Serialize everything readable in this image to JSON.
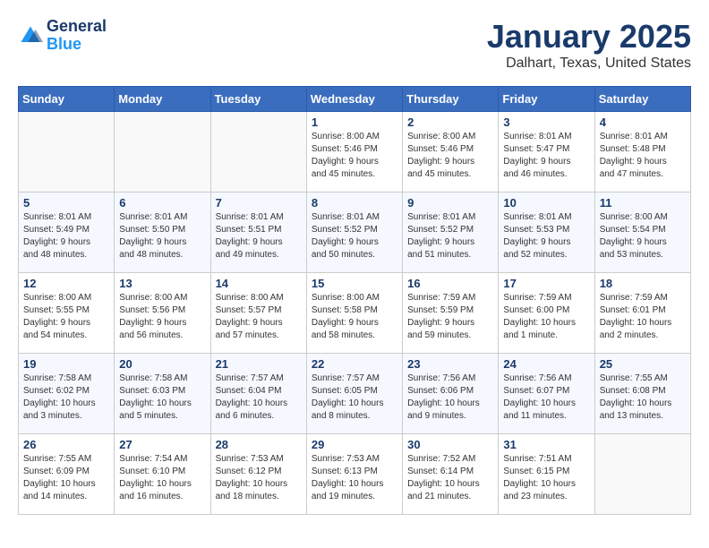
{
  "header": {
    "logo_line1": "General",
    "logo_line2": "Blue",
    "title": "January 2025",
    "subtitle": "Dalhart, Texas, United States"
  },
  "weekdays": [
    "Sunday",
    "Monday",
    "Tuesday",
    "Wednesday",
    "Thursday",
    "Friday",
    "Saturday"
  ],
  "weeks": [
    [
      {
        "day": "",
        "info": ""
      },
      {
        "day": "",
        "info": ""
      },
      {
        "day": "",
        "info": ""
      },
      {
        "day": "1",
        "info": "Sunrise: 8:00 AM\nSunset: 5:46 PM\nDaylight: 9 hours\nand 45 minutes."
      },
      {
        "day": "2",
        "info": "Sunrise: 8:00 AM\nSunset: 5:46 PM\nDaylight: 9 hours\nand 45 minutes."
      },
      {
        "day": "3",
        "info": "Sunrise: 8:01 AM\nSunset: 5:47 PM\nDaylight: 9 hours\nand 46 minutes."
      },
      {
        "day": "4",
        "info": "Sunrise: 8:01 AM\nSunset: 5:48 PM\nDaylight: 9 hours\nand 47 minutes."
      }
    ],
    [
      {
        "day": "5",
        "info": "Sunrise: 8:01 AM\nSunset: 5:49 PM\nDaylight: 9 hours\nand 48 minutes."
      },
      {
        "day": "6",
        "info": "Sunrise: 8:01 AM\nSunset: 5:50 PM\nDaylight: 9 hours\nand 48 minutes."
      },
      {
        "day": "7",
        "info": "Sunrise: 8:01 AM\nSunset: 5:51 PM\nDaylight: 9 hours\nand 49 minutes."
      },
      {
        "day": "8",
        "info": "Sunrise: 8:01 AM\nSunset: 5:52 PM\nDaylight: 9 hours\nand 50 minutes."
      },
      {
        "day": "9",
        "info": "Sunrise: 8:01 AM\nSunset: 5:52 PM\nDaylight: 9 hours\nand 51 minutes."
      },
      {
        "day": "10",
        "info": "Sunrise: 8:01 AM\nSunset: 5:53 PM\nDaylight: 9 hours\nand 52 minutes."
      },
      {
        "day": "11",
        "info": "Sunrise: 8:00 AM\nSunset: 5:54 PM\nDaylight: 9 hours\nand 53 minutes."
      }
    ],
    [
      {
        "day": "12",
        "info": "Sunrise: 8:00 AM\nSunset: 5:55 PM\nDaylight: 9 hours\nand 54 minutes."
      },
      {
        "day": "13",
        "info": "Sunrise: 8:00 AM\nSunset: 5:56 PM\nDaylight: 9 hours\nand 56 minutes."
      },
      {
        "day": "14",
        "info": "Sunrise: 8:00 AM\nSunset: 5:57 PM\nDaylight: 9 hours\nand 57 minutes."
      },
      {
        "day": "15",
        "info": "Sunrise: 8:00 AM\nSunset: 5:58 PM\nDaylight: 9 hours\nand 58 minutes."
      },
      {
        "day": "16",
        "info": "Sunrise: 7:59 AM\nSunset: 5:59 PM\nDaylight: 9 hours\nand 59 minutes."
      },
      {
        "day": "17",
        "info": "Sunrise: 7:59 AM\nSunset: 6:00 PM\nDaylight: 10 hours\nand 1 minute."
      },
      {
        "day": "18",
        "info": "Sunrise: 7:59 AM\nSunset: 6:01 PM\nDaylight: 10 hours\nand 2 minutes."
      }
    ],
    [
      {
        "day": "19",
        "info": "Sunrise: 7:58 AM\nSunset: 6:02 PM\nDaylight: 10 hours\nand 3 minutes."
      },
      {
        "day": "20",
        "info": "Sunrise: 7:58 AM\nSunset: 6:03 PM\nDaylight: 10 hours\nand 5 minutes."
      },
      {
        "day": "21",
        "info": "Sunrise: 7:57 AM\nSunset: 6:04 PM\nDaylight: 10 hours\nand 6 minutes."
      },
      {
        "day": "22",
        "info": "Sunrise: 7:57 AM\nSunset: 6:05 PM\nDaylight: 10 hours\nand 8 minutes."
      },
      {
        "day": "23",
        "info": "Sunrise: 7:56 AM\nSunset: 6:06 PM\nDaylight: 10 hours\nand 9 minutes."
      },
      {
        "day": "24",
        "info": "Sunrise: 7:56 AM\nSunset: 6:07 PM\nDaylight: 10 hours\nand 11 minutes."
      },
      {
        "day": "25",
        "info": "Sunrise: 7:55 AM\nSunset: 6:08 PM\nDaylight: 10 hours\nand 13 minutes."
      }
    ],
    [
      {
        "day": "26",
        "info": "Sunrise: 7:55 AM\nSunset: 6:09 PM\nDaylight: 10 hours\nand 14 minutes."
      },
      {
        "day": "27",
        "info": "Sunrise: 7:54 AM\nSunset: 6:10 PM\nDaylight: 10 hours\nand 16 minutes."
      },
      {
        "day": "28",
        "info": "Sunrise: 7:53 AM\nSunset: 6:12 PM\nDaylight: 10 hours\nand 18 minutes."
      },
      {
        "day": "29",
        "info": "Sunrise: 7:53 AM\nSunset: 6:13 PM\nDaylight: 10 hours\nand 19 minutes."
      },
      {
        "day": "30",
        "info": "Sunrise: 7:52 AM\nSunset: 6:14 PM\nDaylight: 10 hours\nand 21 minutes."
      },
      {
        "day": "31",
        "info": "Sunrise: 7:51 AM\nSunset: 6:15 PM\nDaylight: 10 hours\nand 23 minutes."
      },
      {
        "day": "",
        "info": ""
      }
    ]
  ]
}
